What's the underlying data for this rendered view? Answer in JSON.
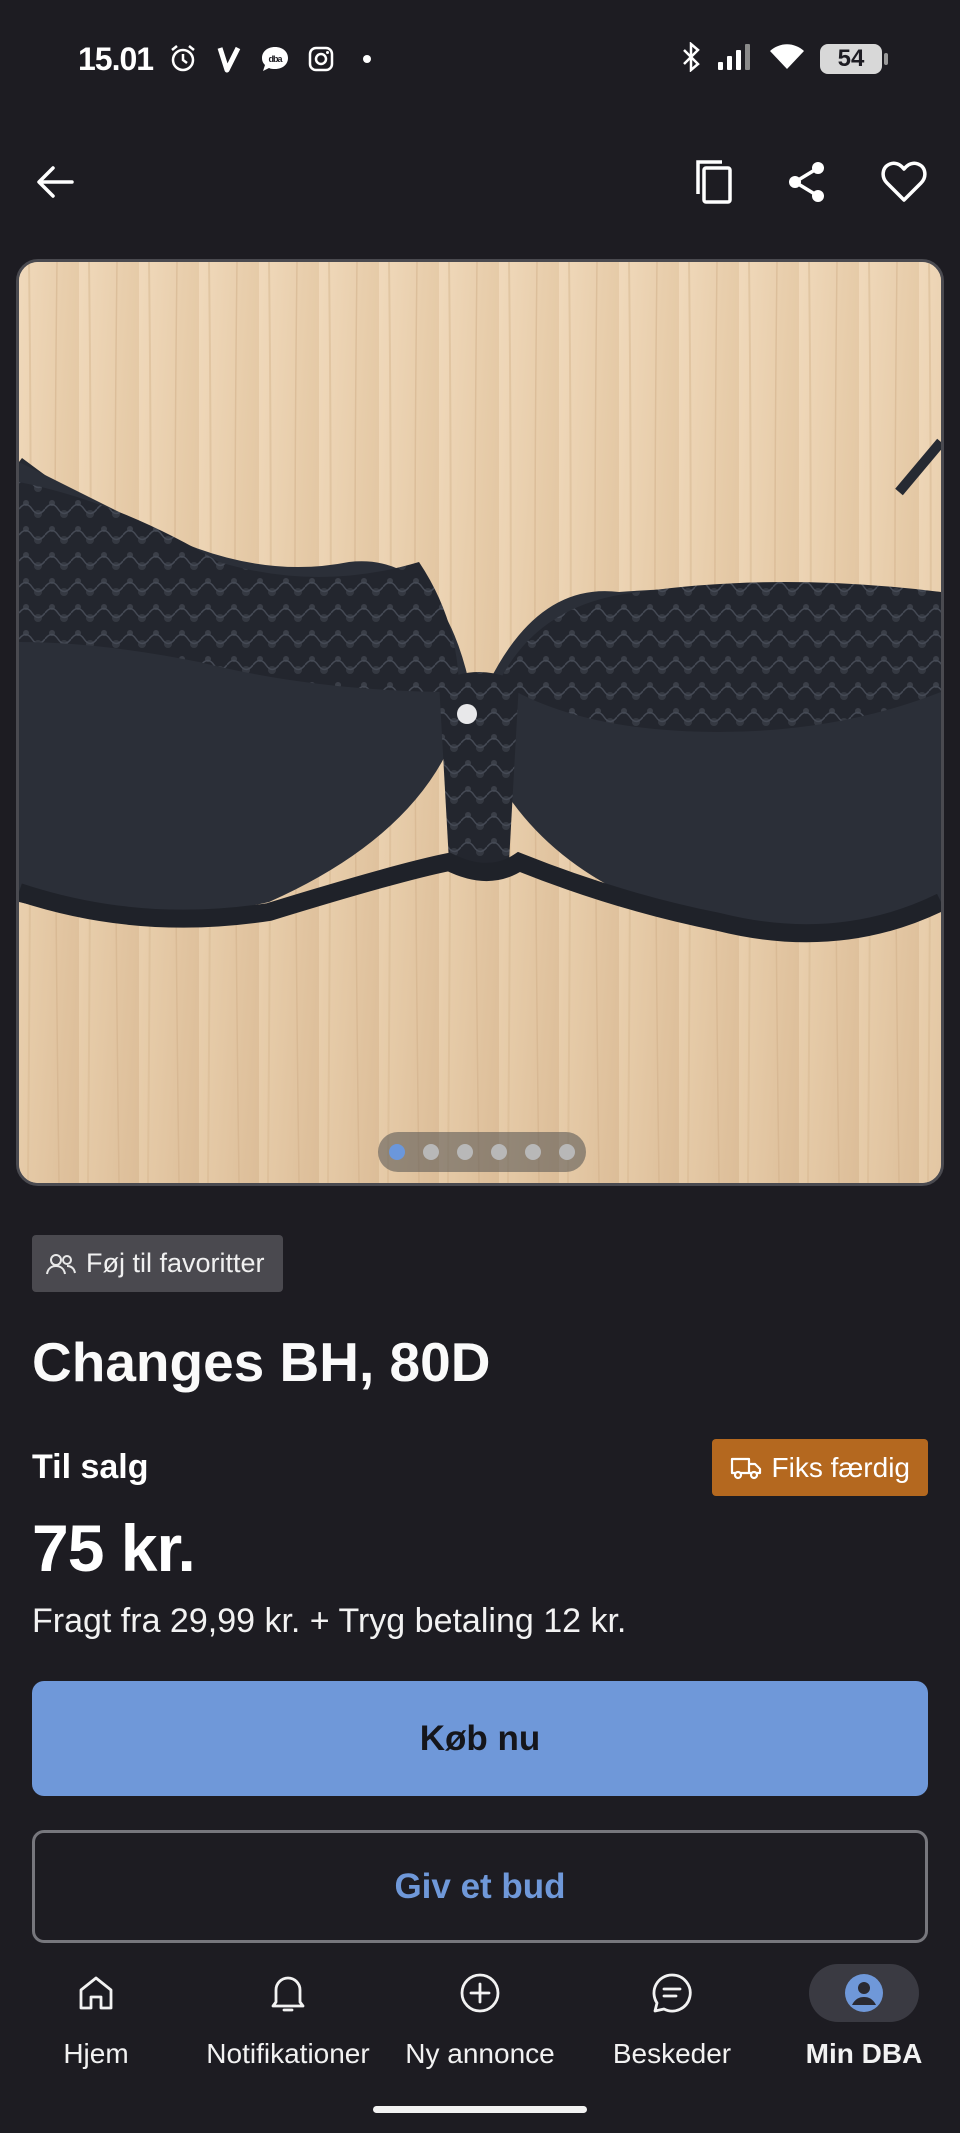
{
  "status_bar": {
    "time": "15.01",
    "battery": "54",
    "icons": [
      "alarm-icon",
      "v-app-icon",
      "dba-chat-icon",
      "instagram-icon",
      "dot-icon",
      "bluetooth-icon",
      "signal-icon",
      "wifi-icon",
      "battery-icon"
    ]
  },
  "top_nav": {
    "icons": [
      "back-arrow-icon",
      "copy-icon",
      "share-icon",
      "heart-icon"
    ]
  },
  "carousel": {
    "total_images": 6,
    "active_index": 0
  },
  "favorites_chip": {
    "label": "Føj til favoritter",
    "icon": "people-icon"
  },
  "listing": {
    "title": "Changes BH, 80D",
    "status": "Til salg",
    "badge": "Fiks færdig",
    "badge_icon": "truck-icon",
    "price": "75 kr.",
    "shipping": "Fragt fra 29,99 kr. + Tryg betaling 12 kr."
  },
  "actions": {
    "buy_label": "Køb nu",
    "bid_label": "Giv et bud"
  },
  "bottom_nav": {
    "items": [
      {
        "label": "Hjem",
        "icon": "home-icon"
      },
      {
        "label": "Notifikationer",
        "icon": "bell-icon"
      },
      {
        "label": "Ny annonce",
        "icon": "plus-circle-icon"
      },
      {
        "label": "Beskeder",
        "icon": "chat-icon"
      },
      {
        "label": "Min DBA",
        "icon": "profile-icon",
        "active": true
      }
    ]
  },
  "colors": {
    "background": "#1d1c22",
    "accent": "#6f98d9",
    "badge": "#b4681f",
    "chip": "#4a494f"
  }
}
